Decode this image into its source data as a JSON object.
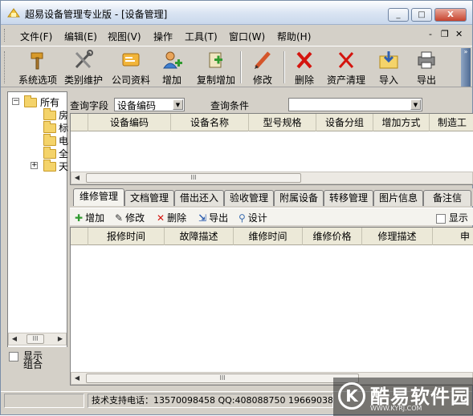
{
  "window": {
    "title": "超易设备管理专业版 - [设备管理]",
    "minimize": "_",
    "maximize": "□",
    "close": "X"
  },
  "menu": [
    "文件(F)",
    "编辑(E)",
    "视图(V)",
    "操作",
    "工具(T)",
    "窗口(W)",
    "帮助(H)"
  ],
  "mdi": {
    "minimize": "-",
    "restore": "❐",
    "close": "✕"
  },
  "toolbar": [
    "系统选项",
    "类别维护",
    "公司资料",
    "增加",
    "复制增加",
    "修改",
    "删除",
    "资产清理",
    "导入",
    "导出"
  ],
  "tree": {
    "root": "所有",
    "nodes": [
      "房",
      "标",
      "电",
      "全",
      "天"
    ]
  },
  "left_panel": {
    "check_label": "显示组合"
  },
  "query": {
    "field_label": "查询字段",
    "field_value": "设备编码",
    "cond_label": "查询条件",
    "cond_value": ""
  },
  "grid_top": {
    "columns": [
      "设备编码",
      "设备名称",
      "型号规格",
      "设备分组",
      "增加方式",
      "制造工"
    ]
  },
  "tabs": [
    "维修管理",
    "文档管理",
    "借出还入",
    "验收管理",
    "附属设备",
    "转移管理",
    "图片信息",
    "备注信"
  ],
  "subtoolbar": {
    "items": [
      "增加",
      "修改",
      "删除",
      "导出",
      "设计"
    ],
    "show_label": "显示"
  },
  "grid_bottom": {
    "columns": [
      "报修时间",
      "故障描述",
      "维修时间",
      "维修价格",
      "修理描述",
      "申"
    ]
  },
  "statusbar": {
    "support": "技术支持电话：13570098458 QQ:408088750 1966903818"
  },
  "watermark": {
    "logo_letter": "K",
    "brand": "酷易软件园",
    "url": "WWW.KYRJ.COM"
  },
  "colors": {
    "delete_red": "#d4140e",
    "add_green": "#2f9a2f",
    "folder": "#f4d36a"
  }
}
